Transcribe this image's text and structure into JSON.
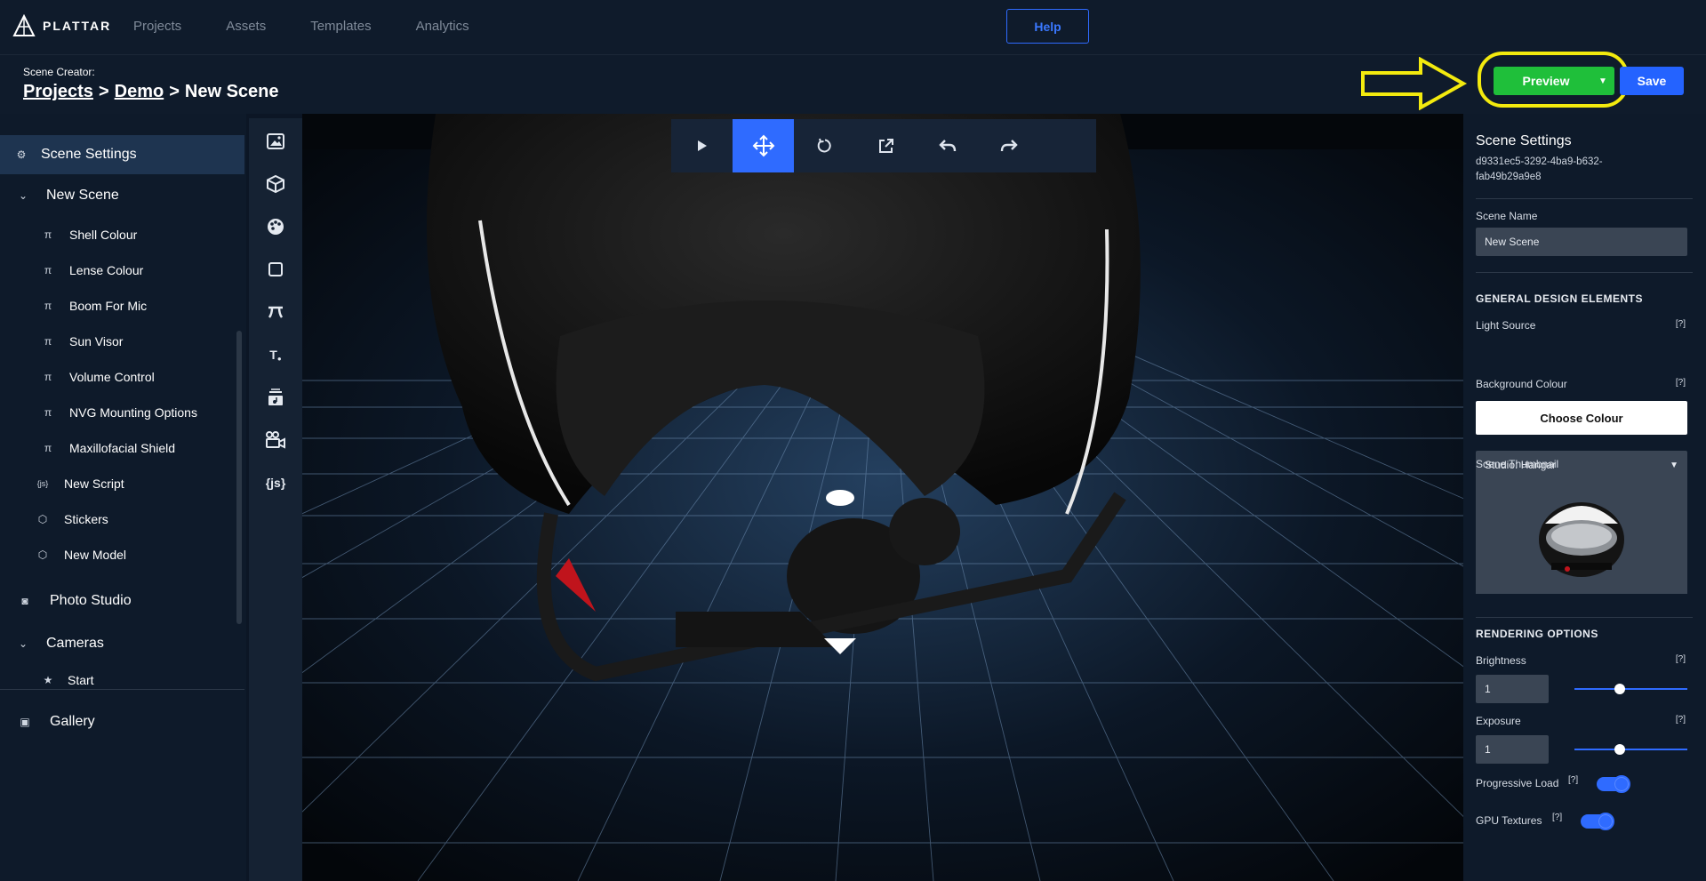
{
  "header": {
    "brand": "PLATTAR",
    "nav": [
      "Projects",
      "Assets",
      "Templates",
      "Analytics"
    ],
    "help_label": "Help"
  },
  "subheader": {
    "scene_creator_label": "Scene Creator:",
    "crumb_projects": "Projects",
    "crumb_sep": ">",
    "crumb_demo": "Demo",
    "crumb_current": "New Scene",
    "preview_label": "Preview",
    "save_label": "Save"
  },
  "sidebar": {
    "scene_settings": "Scene Settings",
    "new_scene": "New Scene",
    "items": [
      "Shell Colour",
      "Lense Colour",
      "Boom For Mic",
      "Sun Visor",
      "Volume Control",
      "NVG Mounting Options",
      "Maxillofacial Shield"
    ],
    "script_item": "New Script",
    "stickers": "Stickers",
    "new_model": "New Model",
    "photo_studio": "Photo Studio",
    "cameras": "Cameras",
    "camera_start": "Start",
    "gallery": "Gallery"
  },
  "toolstrip": {
    "js_label": "{js}"
  },
  "settings": {
    "title": "Scene Settings",
    "scene_id": "d9331ec5-3292-4ba9-b632-fab49b29a9e8",
    "scene_name_label": "Scene Name",
    "scene_name_value": "New Scene",
    "general_heading": "GENERAL DESIGN ELEMENTS",
    "light_source_label": "Light Source",
    "light_source_value": "Studio: Hangar",
    "background_label": "Background Colour",
    "choose_colour": "Choose Colour",
    "thumbnail_label": "Scene Thumbnail",
    "rendering_heading": "RENDERING OPTIONS",
    "brightness_label": "Brightness",
    "brightness_value": "1",
    "brightness_level": 0.4,
    "exposure_label": "Exposure",
    "exposure_value": "1",
    "exposure_level": 0.4,
    "progressive_label": "Progressive Load",
    "progressive_on": true,
    "gpu_label": "GPU Textures",
    "gpu_on": true,
    "help_marker": "[?]"
  },
  "colors": {
    "accent": "#2f6bff",
    "preview_green": "#1fbf3a",
    "annotation_yellow": "#f3ea0e"
  }
}
